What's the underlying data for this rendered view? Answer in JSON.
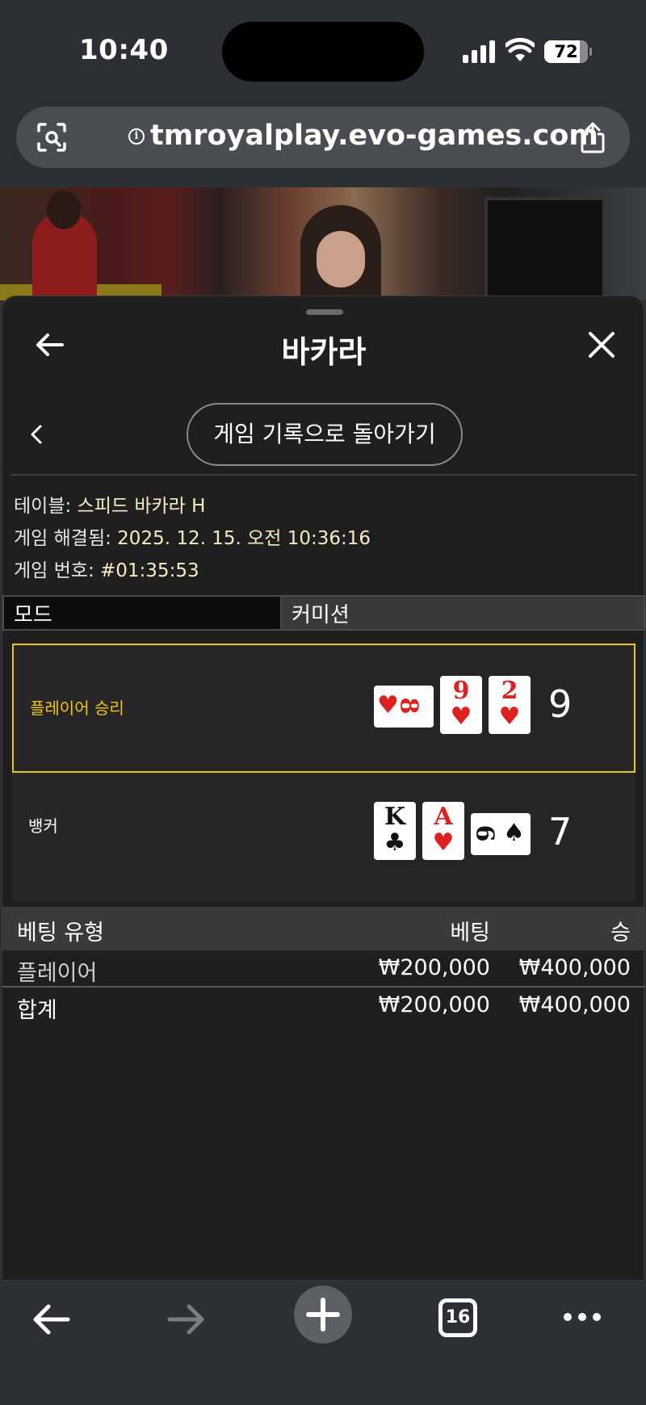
{
  "status": {
    "time": "10:40",
    "battery": "72"
  },
  "browser": {
    "url": "tmroyalplay.evo-games.com",
    "tabs_count": "16"
  },
  "panel": {
    "title": "바카라",
    "history_button": "게임 기록으로 돌아가기",
    "info": [
      {
        "label": "테이블: ",
        "value": "스피드 바카라 H"
      },
      {
        "label": "게임 해결됨: ",
        "value": "2025. 12. 15. 오전 10:36:16"
      },
      {
        "label": "게임 번호: ",
        "value": "#01:35:53"
      }
    ],
    "mode": {
      "label": "모드",
      "value": "커미션"
    },
    "results": [
      {
        "label": "플레이어 승리",
        "score": "9",
        "winner": true,
        "cards": [
          {
            "rank": "8",
            "suit": "♥"
          },
          {
            "rank": "9",
            "suit": "♥"
          },
          {
            "rank": "2",
            "suit": "♥"
          }
        ]
      },
      {
        "label": "뱅커",
        "score": "7",
        "winner": false,
        "cards": [
          {
            "rank": "K",
            "suit": "♣"
          },
          {
            "rank": "A",
            "suit": "♥"
          },
          {
            "rank": "6",
            "suit": "♠"
          }
        ]
      }
    ],
    "bets": {
      "headers": {
        "type": "베팅 유형",
        "bet": "베팅",
        "win": "승"
      },
      "rows": [
        {
          "type": "플레이어",
          "bet": "₩200,000",
          "win": "₩400,000"
        }
      ],
      "total": {
        "type": "합계",
        "bet": "₩200,000",
        "win": "₩400,000"
      }
    }
  },
  "colors": {
    "accent": "#e8c51c",
    "win_text": "#f2c51a",
    "card_red": "#e0201f",
    "panel_bg": "#1f1f1f"
  },
  "icons": [
    "camera-search-icon",
    "info-icon",
    "share-icon",
    "back-arrow-icon",
    "close-icon",
    "chevron-left-icon",
    "plus-icon",
    "tabs-icon",
    "more-icon"
  ]
}
